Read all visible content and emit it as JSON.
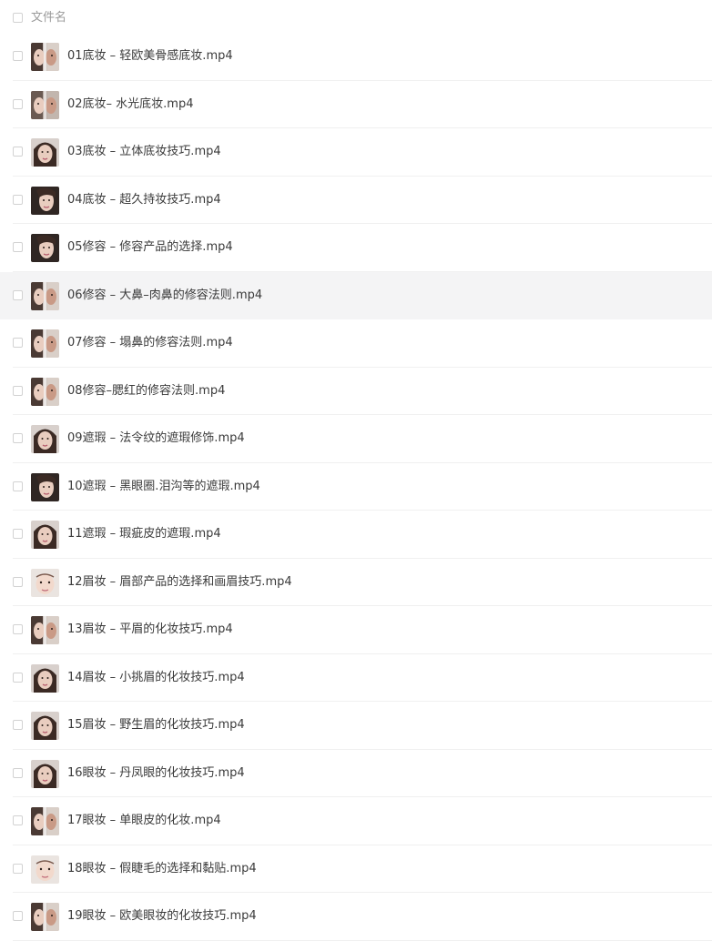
{
  "header": {
    "column_label": "文件名"
  },
  "files": [
    {
      "name": "01底妆 – 轻欧美骨感底妆.mp4",
      "thumb": "face-split"
    },
    {
      "name": "02底妆– 水光底妆.mp4",
      "thumb": "face-split-dim"
    },
    {
      "name": "03底妆 – 立体底妆技巧.mp4",
      "thumb": "face-portrait"
    },
    {
      "name": "04底妆 – 超久持妆技巧.mp4",
      "thumb": "face-dark"
    },
    {
      "name": "05修容 – 修容产品的选择.mp4",
      "thumb": "face-dark"
    },
    {
      "name": "06修容 – 大鼻–肉鼻的修容法则.mp4",
      "thumb": "face-split",
      "highlighted": true
    },
    {
      "name": "07修容 – 塌鼻的修容法则.mp4",
      "thumb": "face-split"
    },
    {
      "name": "08修容–腮红的修容法则.mp4",
      "thumb": "face-split"
    },
    {
      "name": "09遮瑕 – 法令纹的遮瑕修饰.mp4",
      "thumb": "face-portrait"
    },
    {
      "name": "10遮瑕 – 黑眼圈.泪沟等的遮瑕.mp4",
      "thumb": "face-dark"
    },
    {
      "name": "11遮瑕 – 瑕疵皮的遮瑕.mp4",
      "thumb": "face-portrait"
    },
    {
      "name": "12眉妆 – 眉部产品的选择和画眉技巧.mp4",
      "thumb": "face-light"
    },
    {
      "name": "13眉妆 – 平眉的化妆技巧.mp4",
      "thumb": "face-split"
    },
    {
      "name": "14眉妆 – 小挑眉的化妆技巧.mp4",
      "thumb": "face-portrait"
    },
    {
      "name": "15眉妆 – 野生眉的化妆技巧.mp4",
      "thumb": "face-portrait"
    },
    {
      "name": "16眼妆 – 丹凤眼的化妆技巧.mp4",
      "thumb": "face-portrait"
    },
    {
      "name": "17眼妆 – 单眼皮的化妆.mp4",
      "thumb": "face-split"
    },
    {
      "name": "18眼妆 – 假睫毛的选择和黏贴.mp4",
      "thumb": "face-light"
    },
    {
      "name": "19眼妆 – 欧美眼妆的化妆技巧.mp4",
      "thumb": "face-split"
    }
  ],
  "colors": {
    "text": "#3a3a3a",
    "muted": "#9a9a9a",
    "checkbox_border": "#d2d2d2",
    "row_separator": "#f0f0f0",
    "row_highlight": "#f4f4f5"
  }
}
